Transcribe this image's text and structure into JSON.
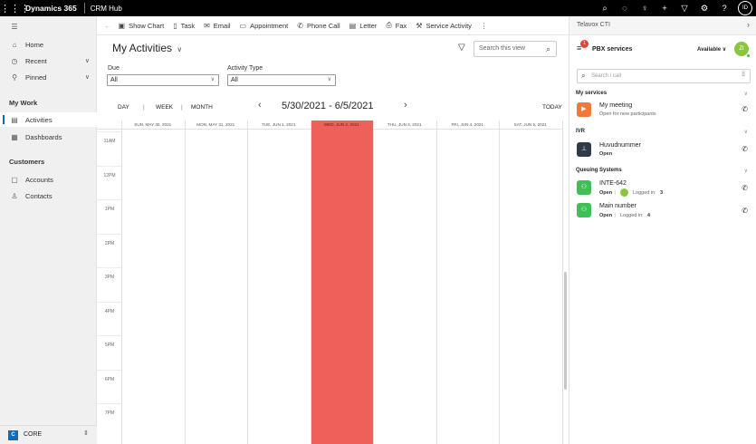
{
  "topbar": {
    "brand": "Dynamics 365",
    "app_name": "CRM Hub",
    "icons": [
      "search-icon",
      "lightbulb-outline-icon",
      "lightbulb-icon",
      "plus-icon",
      "filter-icon",
      "gear-icon",
      "help-icon"
    ],
    "user_initials": "ID"
  },
  "leftnav": {
    "items": [
      {
        "label": "Home",
        "icon": "home-icon"
      },
      {
        "label": "Recent",
        "icon": "clock-icon"
      },
      {
        "label": "Pinned",
        "icon": "pin-icon"
      }
    ],
    "my_work_title": "My Work",
    "my_work": [
      {
        "label": "Activities",
        "icon": "clipboard-icon"
      },
      {
        "label": "Dashboards",
        "icon": "dashboard-icon"
      }
    ],
    "customers_title": "Customers",
    "customers": [
      {
        "label": "Accounts",
        "icon": "building-icon"
      },
      {
        "label": "Contacts",
        "icon": "person-icon"
      }
    ],
    "area_badge": "C",
    "area_label": "CORE"
  },
  "toolbar": {
    "items": [
      {
        "label": "Show Chart",
        "icon": "chart-icon"
      },
      {
        "label": "Task",
        "icon": "task-icon"
      },
      {
        "label": "Email",
        "icon": "email-icon"
      },
      {
        "label": "Appointment",
        "icon": "calendar-icon"
      },
      {
        "label": "Phone Call",
        "icon": "phone-icon"
      },
      {
        "label": "Letter",
        "icon": "letter-icon"
      },
      {
        "label": "Fax",
        "icon": "fax-icon"
      },
      {
        "label": "Service Activity",
        "icon": "service-icon"
      }
    ]
  },
  "view": {
    "title": "My Activities",
    "search_placeholder": "Search this view",
    "filters": {
      "due_label": "Due",
      "due_value": "All",
      "type_label": "Activity Type",
      "type_value": "All"
    }
  },
  "calendar": {
    "modes": [
      "DAY",
      "WEEK",
      "MONTH"
    ],
    "range": "5/30/2021 - 6/5/2021",
    "today": "TODAY",
    "days": [
      "SUN, MAY 30, 2021",
      "MON, MAY 31, 2021",
      "TUE, JUN 1, 2021",
      "WED, JUN 2, 2021",
      "THU, JUN 3, 2021",
      "FRI, JUN 4, 2021",
      "SAT, JUN 5, 2021"
    ],
    "hours": [
      "11AM",
      "12PM",
      "1PM",
      "2PM",
      "3PM",
      "4PM",
      "5PM",
      "6PM",
      "7PM"
    ],
    "highlighted_day_index": 3,
    "highlight_color": "#f0605a"
  },
  "cti": {
    "title": "Telavox CTI",
    "pbx_label": "PBX services",
    "notification_count": "1",
    "status": "Available",
    "agent_initials": "ZI",
    "search_placeholder": "Search / call",
    "my_services_title": "My services",
    "my_services": [
      {
        "name": "My meeting",
        "status": "Open for new participants",
        "color": "#f07a3a",
        "icon": "video-icon"
      }
    ],
    "ivr_title": "IVR",
    "ivr": [
      {
        "name": "Huvudnummer",
        "status": "Open",
        "color": "#2f3b4a",
        "icon": "tree-icon"
      }
    ],
    "queue_title": "Queuing Systems",
    "queues": [
      {
        "name": "INTE-642",
        "status": "Open",
        "logged_in_label": "Logged in:",
        "logged_in": "3",
        "color": "#3fbf55",
        "icon": "group-icon"
      },
      {
        "name": "Main number",
        "status": "Open",
        "logged_in_label": "Logged in:",
        "logged_in": "4",
        "color": "#3fbf55",
        "icon": "group-icon"
      }
    ]
  }
}
